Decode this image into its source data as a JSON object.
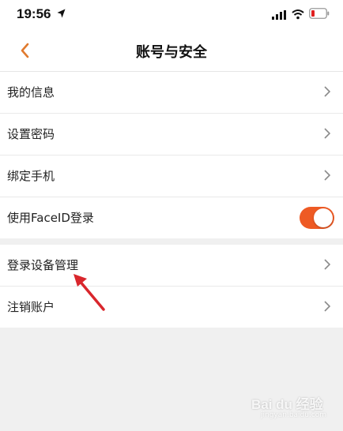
{
  "status": {
    "time": "19:56"
  },
  "nav": {
    "title": "账号与安全"
  },
  "group1": [
    {
      "label": "我的信息"
    },
    {
      "label": "设置密码"
    },
    {
      "label": "绑定手机"
    }
  ],
  "faceid": {
    "label": "使用FaceID登录",
    "enabled": true
  },
  "group2": [
    {
      "label": "登录设备管理"
    },
    {
      "label": "注销账户"
    }
  ],
  "colors": {
    "accent": "#ee5a24",
    "back_arrow": "#e07a2e",
    "annotation": "#d9262c"
  },
  "watermark": {
    "text": "Bai du 经验",
    "sub": "jingyan.baidu.com"
  }
}
